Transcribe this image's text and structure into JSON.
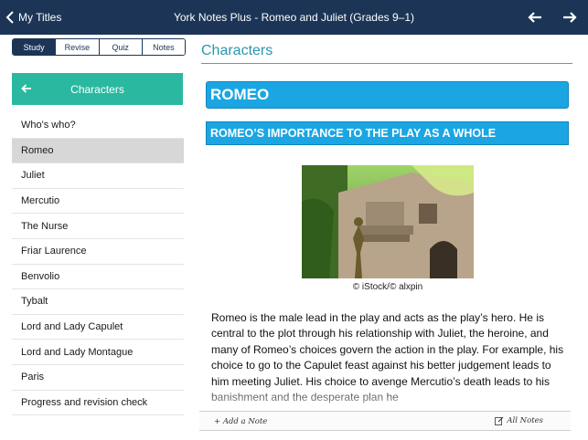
{
  "topbar": {
    "back_label": "My Titles",
    "title": "York Notes Plus - Romeo and Juliet (Grades 9–1)"
  },
  "tabs": [
    {
      "label": "Study",
      "active": true
    },
    {
      "label": "Revise",
      "active": false
    },
    {
      "label": "Quiz",
      "active": false
    },
    {
      "label": "Notes",
      "active": false
    }
  ],
  "sidebar": {
    "header": "Characters",
    "items": [
      {
        "label": "Who's who?",
        "selected": false
      },
      {
        "label": "Romeo",
        "selected": true
      },
      {
        "label": "Juliet",
        "selected": false
      },
      {
        "label": "Mercutio",
        "selected": false
      },
      {
        "label": "The Nurse",
        "selected": false
      },
      {
        "label": "Friar Laurence",
        "selected": false
      },
      {
        "label": "Benvolio",
        "selected": false
      },
      {
        "label": "Tybalt",
        "selected": false
      },
      {
        "label": "Lord and Lady Capulet",
        "selected": false
      },
      {
        "label": "Lord and Lady Montague",
        "selected": false
      },
      {
        "label": "Paris",
        "selected": false
      },
      {
        "label": "Progress and revision check",
        "selected": false
      }
    ]
  },
  "main": {
    "heading": "Characters",
    "banner_title": "ROMEO",
    "banner_subtitle": "ROMEO’S IMPORTANCE TO THE PLAY AS A WHOLE",
    "image_caption": "© iStock/© alxpin",
    "body": "Romeo is the male lead in the play and acts as the play’s hero. He is central to the plot through his relationship with Juliet, the heroine, and many of Romeo’s choices govern the action in the play. For example, his choice to go to the Capulet feast against his better judgement leads to him meeting Juliet. His choice to avenge Mercutio’s death leads to his banishment and the desperate plan he"
  },
  "notes_bar": {
    "add_note": "+ Add a Note",
    "all_notes": "All Notes"
  },
  "colors": {
    "navbar": "#1c3557",
    "teal": "#2ab9a0",
    "banner_blue": "#1ba6e3",
    "heading_blue": "#2a96b0"
  },
  "icons": {
    "back": "chevron-left-icon",
    "prev": "arrow-left-icon",
    "next": "arrow-right-icon",
    "sidebar_back": "arrow-left-icon",
    "notes": "edit-note-icon"
  }
}
